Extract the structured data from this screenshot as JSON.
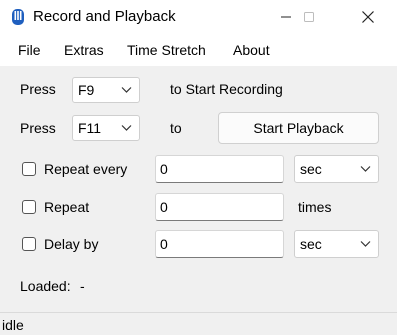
{
  "window": {
    "title": "Record and Playback",
    "icon": "app-icon",
    "controls": [
      "minimize-icon",
      "maximize-icon",
      "close-icon"
    ]
  },
  "menu": {
    "items": [
      "File",
      "Extras",
      "Time Stretch",
      "About"
    ]
  },
  "record_row": {
    "press_label": "Press",
    "key": "F9",
    "suffix": "to Start Recording"
  },
  "playback_row": {
    "press_label": "Press",
    "key": "F11",
    "to_label": "to",
    "button_label": "Start Playback"
  },
  "repeat_every": {
    "label": "Repeat every",
    "checked": false,
    "value": "0",
    "unit": "sec"
  },
  "repeat": {
    "label": "Repeat",
    "checked": false,
    "value": "0",
    "unit": "times"
  },
  "delay_by": {
    "label": "Delay by",
    "checked": false,
    "value": "0",
    "unit": "sec"
  },
  "loaded": {
    "label": "Loaded:",
    "value": "-"
  },
  "status": {
    "text": "idle"
  }
}
